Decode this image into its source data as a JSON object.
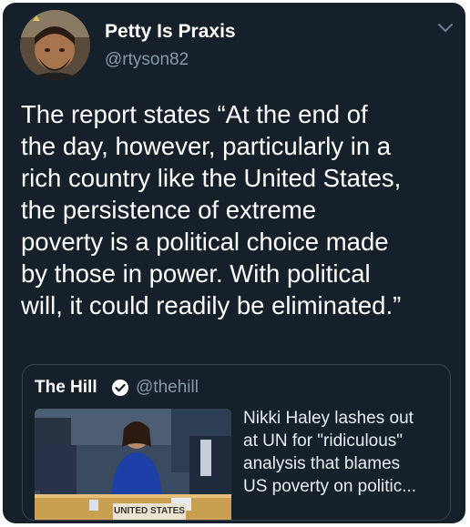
{
  "tweet": {
    "author": {
      "display_name": "Petty Is Praxis",
      "handle": "@rtyson82",
      "avatar_icon": "avatar-photo"
    },
    "menu_icon": "chevron-down-icon",
    "text_lines": [
      "The report states “At the end of",
      "the day, however, particularly in a",
      "rich country like the United States,",
      "the persistence of extreme",
      "poverty is a political choice made",
      "by those in power. With political",
      "will, it could readily be eliminated.”"
    ]
  },
  "quote": {
    "display_name": "The Hill",
    "verified_icon": "verified-badge-icon",
    "handle": "@thehill",
    "image_caption": "UNITED STATES",
    "headline_lines": [
      "Nikki Haley lashes out",
      "at UN for \"ridiculous\"",
      "analysis that blames",
      "US poverty on politic..."
    ]
  },
  "colors": {
    "background": "#15202b",
    "text": "#ffffff",
    "secondary_text": "#8899a6",
    "border": "#38444d"
  }
}
